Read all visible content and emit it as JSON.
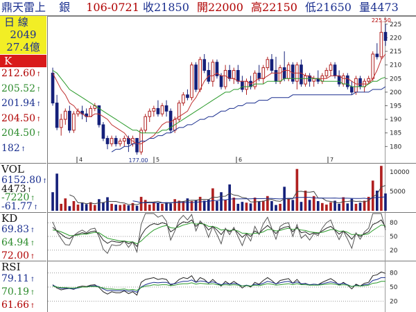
{
  "header": {
    "name": "鼎天雷上",
    "tag": "銀",
    "date": "106-0721",
    "close_label": "收",
    "close": "21850",
    "open_label": "開",
    "open": "22000",
    "high_label": "高",
    "high": "22150",
    "low_label": "低",
    "low": "21650",
    "vol_label": "量",
    "vol": "4473"
  },
  "info_box": {
    "period": "日 線",
    "volume": "2049",
    "amount": "27.4億"
  },
  "k_panel": {
    "title": "K",
    "values": [
      {
        "text": "212.60",
        "color": "#b00000"
      },
      {
        "text": "205.52",
        "color": "#2a8a2a"
      },
      {
        "text": "201.94",
        "color": "#1a2f8f"
      },
      {
        "text": "204.50",
        "color": "#b00000"
      },
      {
        "text": "204.50",
        "color": "#2a8a2a"
      },
      {
        "text": "182",
        "color": "#1a2f8f"
      }
    ],
    "y_ticks": [
      "225",
      "220",
      "215",
      "210",
      "205",
      "200",
      "195",
      "190",
      "185",
      "180"
    ],
    "y_min": 176,
    "y_max": 227,
    "max_label": "225.50",
    "min_label": "177.00",
    "x_ticks": [
      "4",
      "5",
      "6",
      "7"
    ]
  },
  "vol_panel": {
    "title": "VOL",
    "values": [
      {
        "text": "6152.80",
        "color": "#1a2f8f"
      },
      {
        "text": "4473",
        "color": "#111"
      },
      {
        "text": "-7220",
        "color": "#2a8a2a"
      },
      {
        "text": "-61.77",
        "color": "#1a2f8f"
      }
    ],
    "y_ticks": [
      "10000",
      "5000"
    ],
    "y_max": 12000
  },
  "kd_panel": {
    "title": "KD",
    "values": [
      {
        "text": "69.83",
        "color": "#1a2f8f"
      },
      {
        "text": "64.94",
        "color": "#2a8a2a"
      },
      {
        "text": "72.00",
        "color": "#b00000"
      }
    ],
    "y_ticks": [
      "80",
      "50",
      "20"
    ]
  },
  "rsi_panel": {
    "title": "RSI",
    "values": [
      {
        "text": "79.11",
        "color": "#1a2f8f"
      },
      {
        "text": "70.19",
        "color": "#2a8a2a"
      },
      {
        "text": "61.66",
        "color": "#b00000"
      }
    ],
    "y_ticks": [
      "80",
      "50",
      "20"
    ]
  },
  "chart_data": {
    "type": "candlestick",
    "candles": [
      [
        207,
        209,
        195,
        196
      ],
      [
        196,
        199,
        186,
        187
      ],
      [
        187,
        192,
        184,
        190
      ],
      [
        190,
        194,
        188,
        193
      ],
      [
        193,
        195,
        185,
        186
      ],
      [
        186,
        193,
        185,
        192
      ],
      [
        192,
        194,
        191,
        193
      ],
      [
        193,
        195,
        190,
        192
      ],
      [
        192,
        194,
        189,
        191
      ],
      [
        191,
        195,
        191,
        194
      ],
      [
        194,
        196,
        193,
        195
      ],
      [
        195,
        195,
        187,
        188
      ],
      [
        188,
        189,
        182,
        183
      ],
      [
        183,
        184,
        179,
        181
      ],
      [
        181,
        184,
        180,
        183
      ],
      [
        183,
        184,
        180,
        181
      ],
      [
        181,
        183,
        180,
        182
      ],
      [
        182,
        184,
        180,
        183
      ],
      [
        183,
        184,
        178,
        181
      ],
      [
        181,
        184,
        180,
        183
      ],
      [
        183,
        183,
        177,
        178
      ],
      [
        178,
        187,
        177,
        186
      ],
      [
        186,
        192,
        185,
        191
      ],
      [
        191,
        194,
        189,
        193
      ],
      [
        193,
        195,
        191,
        194
      ],
      [
        194,
        197,
        191,
        192
      ],
      [
        192,
        196,
        191,
        195
      ],
      [
        195,
        197,
        191,
        193
      ],
      [
        193,
        194,
        185,
        186
      ],
      [
        186,
        191,
        185,
        190
      ],
      [
        190,
        197,
        189,
        196
      ],
      [
        196,
        200,
        195,
        199
      ],
      [
        199,
        201,
        197,
        198
      ],
      [
        198,
        211,
        197,
        210
      ],
      [
        210,
        211,
        200,
        201
      ],
      [
        201,
        213,
        200,
        212
      ],
      [
        212,
        214,
        207,
        208
      ],
      [
        208,
        211,
        203,
        204
      ],
      [
        204,
        212,
        202,
        211
      ],
      [
        211,
        212,
        205,
        206
      ],
      [
        206,
        207,
        201,
        202
      ],
      [
        202,
        210,
        201,
        208
      ],
      [
        208,
        210,
        204,
        205
      ],
      [
        205,
        209,
        203,
        208
      ],
      [
        208,
        210,
        203,
        204
      ],
      [
        204,
        206,
        200,
        201
      ],
      [
        201,
        205,
        199,
        204
      ],
      [
        204,
        206,
        201,
        202
      ],
      [
        202,
        208,
        201,
        207
      ],
      [
        207,
        210,
        204,
        205
      ],
      [
        205,
        210,
        203,
        209
      ],
      [
        209,
        213,
        208,
        212
      ],
      [
        212,
        214,
        207,
        208
      ],
      [
        208,
        213,
        203,
        204
      ],
      [
        204,
        210,
        203,
        209
      ],
      [
        209,
        215,
        204,
        205
      ],
      [
        205,
        211,
        204,
        210
      ],
      [
        210,
        211,
        203,
        204
      ],
      [
        204,
        211,
        201,
        210
      ],
      [
        210,
        212,
        202,
        203
      ],
      [
        203,
        207,
        202,
        206
      ],
      [
        206,
        207,
        202,
        204
      ],
      [
        204,
        206,
        202,
        205
      ],
      [
        205,
        208,
        203,
        204
      ],
      [
        204,
        207,
        203,
        206
      ],
      [
        206,
        209,
        205,
        208
      ],
      [
        208,
        211,
        206,
        210
      ],
      [
        210,
        211,
        205,
        206
      ],
      [
        206,
        208,
        202,
        203
      ],
      [
        203,
        207,
        202,
        206
      ],
      [
        206,
        207,
        201,
        202
      ],
      [
        202,
        204,
        199,
        200
      ],
      [
        200,
        206,
        199,
        205
      ],
      [
        205,
        206,
        201,
        202
      ],
      [
        202,
        205,
        200,
        204
      ],
      [
        204,
        206,
        203,
        205
      ],
      [
        205,
        215,
        204,
        214
      ],
      [
        214,
        218,
        212,
        213
      ],
      [
        213,
        226,
        212,
        222
      ],
      [
        222,
        225,
        217,
        219
      ]
    ],
    "ma_red": [
      207,
      204,
      201,
      199,
      196,
      195,
      193,
      192,
      191,
      191,
      192,
      192,
      191,
      190,
      188,
      187,
      186,
      185,
      183,
      182,
      181,
      181,
      182,
      183,
      184,
      186,
      188,
      189,
      189,
      190,
      191,
      192,
      193,
      196,
      198,
      201,
      204,
      206,
      206,
      207,
      206,
      206,
      205,
      205,
      204,
      204,
      204,
      203,
      204,
      205,
      205,
      206,
      207,
      207,
      207,
      208,
      208,
      207,
      207,
      207,
      206,
      206,
      205,
      205,
      205,
      205,
      206,
      206,
      206,
      205,
      205,
      204,
      203,
      203,
      203,
      203,
      205,
      208,
      212,
      214
    ],
    "ma_green": [
      208,
      207,
      205,
      203,
      201,
      200,
      199,
      198,
      197,
      196,
      195,
      194,
      193,
      192,
      191,
      190,
      189,
      188,
      187,
      186,
      186,
      185,
      185,
      185,
      185,
      185,
      186,
      186,
      187,
      188,
      189,
      190,
      191,
      192,
      193,
      194,
      195,
      196,
      197,
      198,
      199,
      200,
      200,
      201,
      201,
      202,
      202,
      202,
      203,
      203,
      203,
      204,
      204,
      204,
      204,
      205,
      205,
      205,
      205,
      205,
      205,
      205,
      205,
      205,
      204,
      204,
      204,
      204,
      204,
      203,
      203,
      202,
      202,
      202,
      202,
      203,
      204,
      204,
      205,
      205.5
    ],
    "ma_blue": [
      null,
      null,
      null,
      null,
      null,
      null,
      null,
      null,
      null,
      null,
      null,
      null,
      null,
      null,
      178,
      179,
      179,
      180,
      180,
      181,
      181,
      182,
      182,
      183,
      183,
      184,
      184,
      185,
      185,
      186,
      187,
      187,
      188,
      188,
      189,
      190,
      190,
      191,
      191,
      192,
      193,
      193,
      194,
      194,
      195,
      195,
      196,
      196,
      196,
      197,
      197,
      197,
      198,
      198,
      198,
      198,
      198,
      199,
      199,
      199,
      199,
      199,
      199,
      199,
      199,
      199,
      199,
      199,
      199,
      199,
      199,
      199,
      200,
      200,
      200,
      200,
      201,
      201,
      201,
      202
    ],
    "volumes": [
      4800,
      9600,
      1800,
      3200,
      1200,
      2500,
      1600,
      2000,
      1700,
      2200,
      1500,
      3000,
      2200,
      3500,
      1800,
      1600,
      1500,
      1700,
      1400,
      2000,
      1300,
      3600,
      2800,
      1600,
      2200,
      2000,
      1800,
      2200,
      1900,
      3000,
      2600,
      2400,
      3200,
      2500,
      2800,
      3600,
      2600,
      2900,
      5800,
      2500,
      4800,
      2800,
      6800,
      3400,
      1800,
      2300,
      2100,
      1900,
      3400,
      2400,
      2600,
      3800,
      2500,
      1500,
      1800,
      6200,
      3100,
      2800,
      10800,
      2300,
      5200,
      2800,
      3800,
      2500,
      2000,
      1600,
      2200,
      2600,
      1800,
      3500,
      1900,
      3100,
      1800,
      2100,
      2600,
      3600,
      7800,
      5200,
      11600,
      4473
    ],
    "k": [
      70,
      62,
      55,
      48,
      45,
      52,
      55,
      58,
      56,
      60,
      62,
      55,
      42,
      35,
      40,
      38,
      37,
      40,
      34,
      38,
      28,
      52,
      66,
      74,
      78,
      76,
      80,
      77,
      60,
      66,
      76,
      82,
      80,
      86,
      72,
      80,
      76,
      64,
      72,
      64,
      54,
      66,
      60,
      66,
      58,
      48,
      56,
      50,
      62,
      56,
      66,
      74,
      66,
      56,
      66,
      70,
      72,
      60,
      70,
      58,
      60,
      54,
      58,
      56,
      62,
      68,
      72,
      64,
      55,
      62,
      54,
      44,
      56,
      50,
      56,
      60,
      76,
      80,
      86,
      70
    ],
    "d": [
      64,
      63,
      60,
      56,
      52,
      52,
      53,
      55,
      55,
      57,
      59,
      58,
      52,
      46,
      44,
      42,
      40,
      40,
      38,
      38,
      34,
      40,
      49,
      57,
      64,
      68,
      72,
      74,
      69,
      68,
      71,
      75,
      77,
      80,
      77,
      78,
      77,
      72,
      72,
      69,
      64,
      65,
      63,
      64,
      62,
      57,
      57,
      55,
      57,
      57,
      60,
      65,
      65,
      62,
      63,
      66,
      68,
      65,
      67,
      64,
      63,
      60,
      59,
      58,
      59,
      62,
      65,
      65,
      61,
      62,
      59,
      54,
      55,
      53,
      54,
      56,
      63,
      69,
      75,
      73
    ],
    "j": [
      82,
      60,
      45,
      32,
      31,
      52,
      59,
      64,
      58,
      66,
      68,
      49,
      22,
      13,
      32,
      30,
      31,
      40,
      26,
      38,
      16,
      76,
      100,
      108,
      106,
      92,
      96,
      83,
      42,
      62,
      86,
      96,
      86,
      98,
      62,
      84,
      74,
      48,
      72,
      54,
      34,
      68,
      54,
      70,
      50,
      30,
      54,
      40,
      72,
      54,
      78,
      92,
      68,
      44,
      72,
      78,
      80,
      50,
      76,
      46,
      54,
      42,
      56,
      52,
      68,
      80,
      86,
      62,
      43,
      62,
      44,
      24,
      58,
      44,
      60,
      68,
      102,
      102,
      108,
      64
    ],
    "rsi1": [
      55,
      48,
      44,
      46,
      47,
      45,
      50,
      52,
      51,
      54,
      55,
      49,
      40,
      35,
      40,
      38,
      38,
      42,
      36,
      40,
      33,
      60,
      66,
      68,
      70,
      66,
      68,
      66,
      54,
      58,
      66,
      70,
      68,
      74,
      60,
      70,
      66,
      58,
      66,
      58,
      52,
      62,
      56,
      62,
      56,
      48,
      54,
      50,
      60,
      56,
      64,
      70,
      64,
      56,
      64,
      66,
      68,
      58,
      66,
      56,
      58,
      54,
      56,
      55,
      60,
      64,
      68,
      62,
      54,
      60,
      54,
      46,
      56,
      52,
      58,
      60,
      74,
      76,
      82,
      79
    ],
    "rsi2": [
      54,
      50,
      47,
      47,
      47,
      46,
      48,
      50,
      50,
      52,
      53,
      51,
      46,
      42,
      43,
      42,
      42,
      43,
      41,
      42,
      39,
      50,
      55,
      58,
      60,
      59,
      60,
      60,
      56,
      57,
      60,
      62,
      62,
      65,
      60,
      63,
      62,
      59,
      61,
      58,
      55,
      58,
      56,
      58,
      56,
      52,
      54,
      52,
      56,
      55,
      58,
      62,
      60,
      57,
      59,
      61,
      62,
      58,
      61,
      57,
      57,
      55,
      56,
      55,
      57,
      59,
      61,
      59,
      56,
      58,
      55,
      51,
      54,
      52,
      55,
      56,
      64,
      66,
      70,
      70
    ],
    "rsi3": [
      52,
      50,
      49,
      49,
      48,
      48,
      49,
      50,
      50,
      51,
      51,
      50,
      48,
      46,
      46,
      45,
      45,
      46,
      44,
      45,
      43,
      49,
      52,
      53,
      55,
      54,
      55,
      55,
      53,
      54,
      56,
      57,
      57,
      59,
      56,
      58,
      57,
      56,
      57,
      55,
      54,
      55,
      54,
      55,
      54,
      52,
      53,
      52,
      54,
      53,
      55,
      57,
      56,
      54,
      55,
      56,
      57,
      55,
      57,
      55,
      55,
      54,
      54,
      54,
      55,
      56,
      57,
      56,
      54,
      55,
      54,
      51,
      53,
      52,
      53,
      54,
      58,
      59,
      62,
      62
    ]
  },
  "colors": {
    "up": "#b02020",
    "down": "#15207a",
    "ma_red": "#c03030",
    "ma_green": "#2a9a2a",
    "ma_blue": "#1a2f8f",
    "grid": "#888888",
    "accent_box": "#f2ee25",
    "title_box": "#d91a1a"
  }
}
